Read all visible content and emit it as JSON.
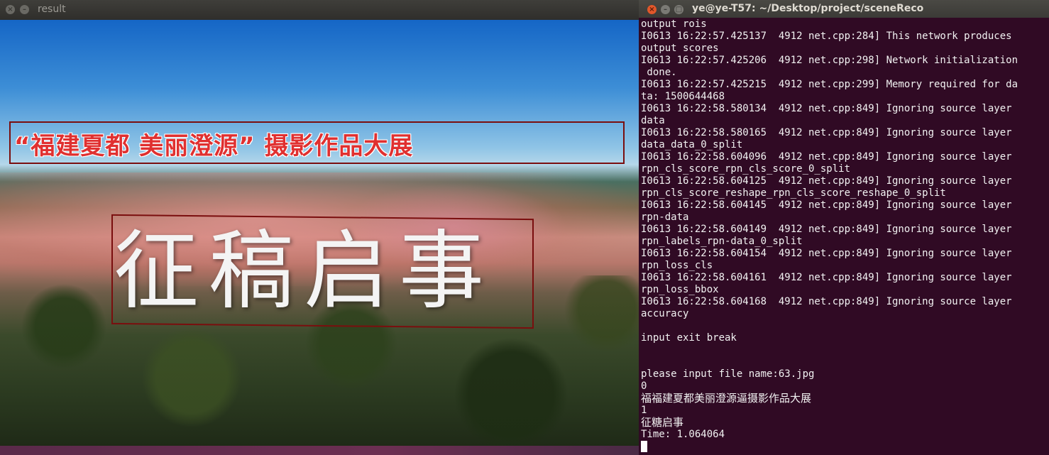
{
  "result_window": {
    "title": "result",
    "buttons": {
      "close": "×",
      "minimize": "–"
    },
    "image": {
      "banner_text": "“福建夏都 美丽澄源” 摄影作品大展",
      "title_text": "征稿启事"
    }
  },
  "terminal_window": {
    "title": "ye@ye-T57: ~/Desktop/project/sceneReco",
    "buttons": {
      "close": "×",
      "minimize": "–",
      "maximize": "□"
    },
    "lines": [
      "output rois",
      "I0613 16:22:57.425137  4912 net.cpp:284] This network produces",
      "output scores",
      "I0613 16:22:57.425206  4912 net.cpp:298] Network initialization",
      " done.",
      "I0613 16:22:57.425215  4912 net.cpp:299] Memory required for da",
      "ta: 1500644468",
      "I0613 16:22:58.580134  4912 net.cpp:849] Ignoring source layer",
      "data",
      "I0613 16:22:58.580165  4912 net.cpp:849] Ignoring source layer",
      "data_data_0_split",
      "I0613 16:22:58.604096  4912 net.cpp:849] Ignoring source layer",
      "rpn_cls_score_rpn_cls_score_0_split",
      "I0613 16:22:58.604125  4912 net.cpp:849] Ignoring source layer",
      "rpn_cls_score_reshape_rpn_cls_score_reshape_0_split",
      "I0613 16:22:58.604145  4912 net.cpp:849] Ignoring source layer",
      "rpn-data",
      "I0613 16:22:58.604149  4912 net.cpp:849] Ignoring source layer",
      "rpn_labels_rpn-data_0_split",
      "I0613 16:22:58.604154  4912 net.cpp:849] Ignoring source layer",
      "rpn_loss_cls",
      "I0613 16:22:58.604161  4912 net.cpp:849] Ignoring source layer",
      "rpn_loss_bbox",
      "I0613 16:22:58.604168  4912 net.cpp:849] Ignoring source layer",
      "accuracy",
      "",
      "input exit break",
      "",
      "",
      "please input file name:63.jpg",
      "0",
      "福福建夏都美丽澄源逼摄影作品大展",
      "1",
      "征糖启事",
      "Time: 1.064064"
    ]
  }
}
